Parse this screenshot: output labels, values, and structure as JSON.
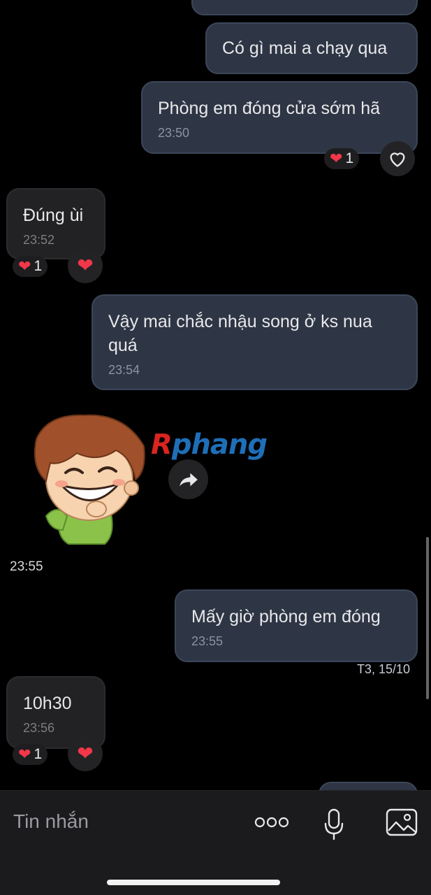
{
  "messages": {
    "m1": {
      "text": "Có gì mai a chạy qua"
    },
    "m2": {
      "text": "Phòng em đóng cửa sớm hã",
      "time": "23:50",
      "reaction_count": "1"
    },
    "m3": {
      "text": "Đúng ùi",
      "time": "23:52",
      "reaction_count": "1"
    },
    "m4": {
      "text": "Vậy mai chắc nhậu song ở ks nua quá",
      "time": "23:54"
    },
    "sticker": {
      "time": "23:55"
    },
    "m5": {
      "text": "Mấy giờ phòng em đóng",
      "time": "23:55"
    },
    "date_label": "T3, 15/10",
    "m6": {
      "text": "10h30",
      "time": "23:56",
      "reaction_count": "1"
    }
  },
  "watermark": {
    "first": "R",
    "rest": "phang"
  },
  "composer": {
    "placeholder": "Tin nhắn"
  },
  "icons": [
    "heart-icon",
    "heart-outline-icon",
    "share-forward-icon",
    "more-dots-icon",
    "microphone-icon",
    "image-icon"
  ],
  "colors": {
    "outgoing_bubble": "#2e3645",
    "incoming_bubble": "#222224",
    "reaction_heart": "#f2374a"
  }
}
